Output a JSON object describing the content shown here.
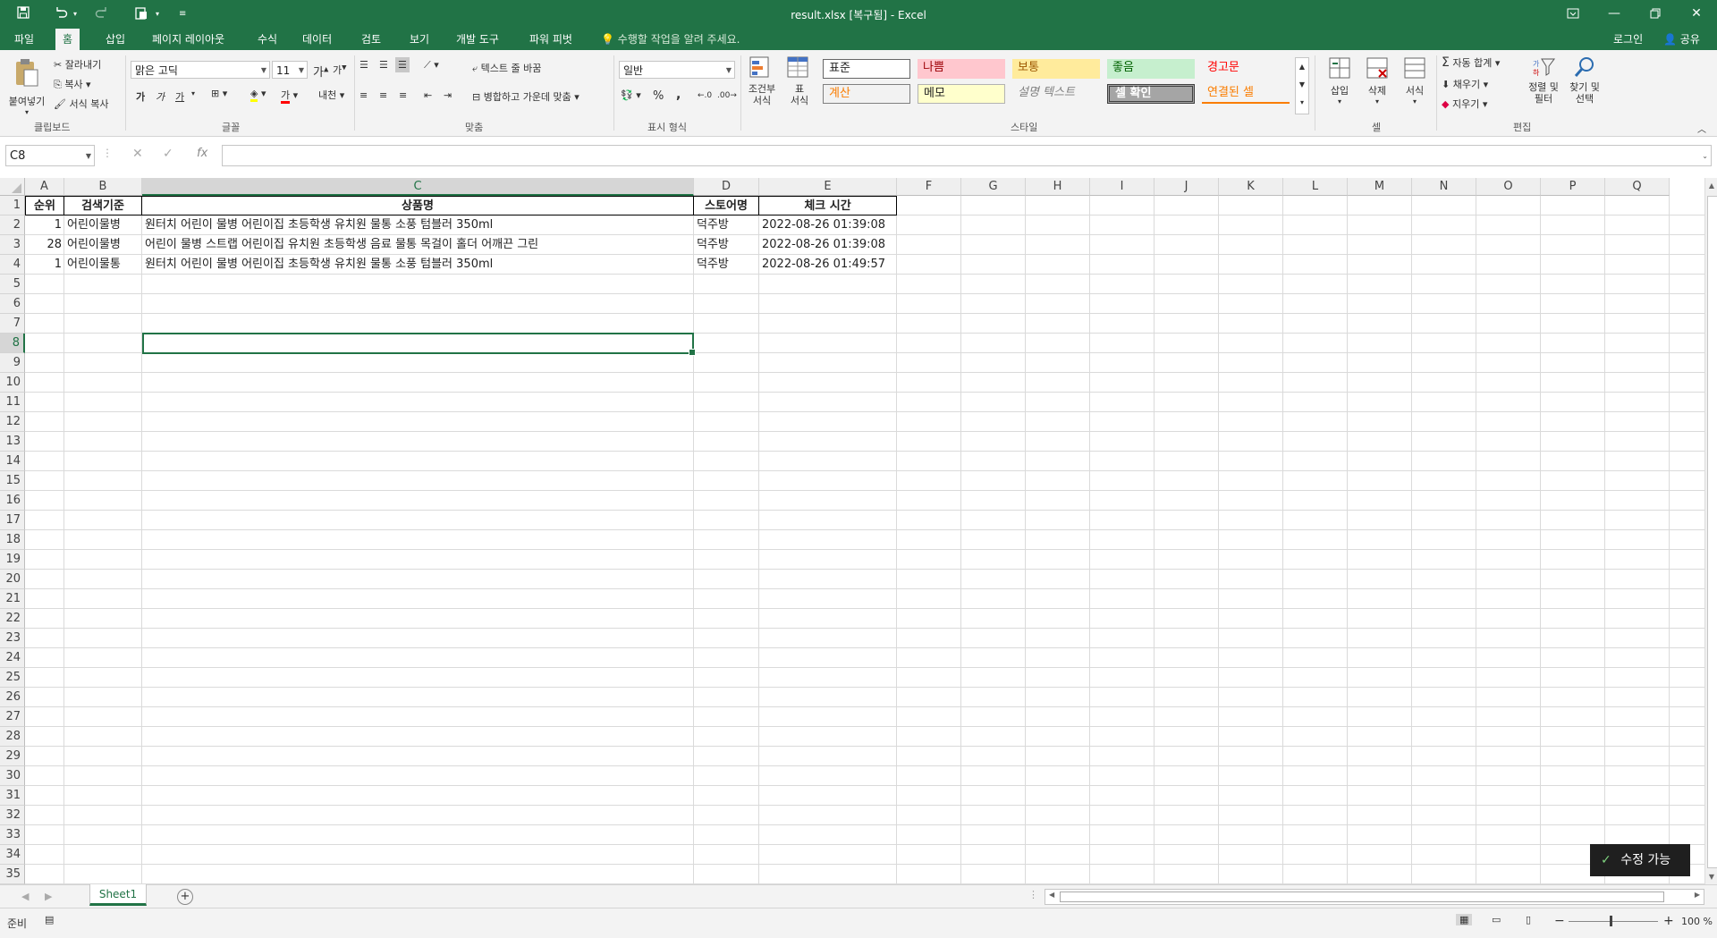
{
  "window": {
    "title": "result.xlsx [복구됨] - Excel"
  },
  "tabs": {
    "file": "파일",
    "home": "홈",
    "insert": "삽입",
    "page_layout": "페이지 레이아웃",
    "formulas": "수식",
    "data": "데이터",
    "review": "검토",
    "view": "보기",
    "developer": "개발 도구",
    "power_pivot": "파워 피벗",
    "tell_me": "수행할 작업을 알려 주세요.",
    "login": "로그인",
    "share": "공유"
  },
  "ribbon": {
    "clipboard": {
      "paste": "붙여넣기",
      "cut": "잘라내기",
      "copy": "복사",
      "format_painter": "서식 복사",
      "label": "클립보드"
    },
    "font": {
      "name": "맑은 고딕",
      "size": "11",
      "bold": "가",
      "italic": "가",
      "underline": "가",
      "label": "글꼴",
      "phonetic": "내천"
    },
    "alignment": {
      "wrap_text": "텍스트 줄 바꿈",
      "merge_center": "병합하고 가운데 맞춤",
      "label": "맞춤"
    },
    "number": {
      "format": "일반",
      "label": "표시 형식",
      "percent": "%",
      "comma": ","
    },
    "styles": {
      "conditional": "조건부\n서식",
      "table": "표\n서식",
      "label": "스타일",
      "cells": [
        "표준",
        "나쁨",
        "보통",
        "좋음",
        "경고문",
        "계산",
        "메모",
        "설명 텍스트",
        "셀 확인",
        "연결된 셀"
      ],
      "colors": {
        "bad_bg": "#ffc7ce",
        "bad_fg": "#9c0006",
        "neutral_bg": "#ffeb9c",
        "neutral_fg": "#9c5700",
        "good_bg": "#c6efce",
        "good_fg": "#006100",
        "warning_fg": "#ff0000",
        "calc_fg": "#fa7d00",
        "linked_fg": "#fa7d00",
        "check_bg": "#a5a5a5"
      }
    },
    "cells": {
      "insert": "삽입",
      "delete": "삭제",
      "format": "서식",
      "label": "셀"
    },
    "editing": {
      "autosum": "자동 합계",
      "fill": "채우기",
      "clear": "지우기",
      "sort": "정렬 및\n필터",
      "find": "찾기 및\n선택",
      "label": "편집"
    }
  },
  "formula_bar": {
    "name_box": "C8",
    "fx": "fx",
    "value": ""
  },
  "grid": {
    "columns": [
      "A",
      "B",
      "C",
      "D",
      "E",
      "F",
      "G",
      "H",
      "I",
      "J",
      "K",
      "L",
      "M",
      "N",
      "O",
      "P",
      "Q"
    ],
    "rows": [
      "1",
      "2",
      "3",
      "4",
      "5",
      "6",
      "7",
      "8",
      "9",
      "10",
      "11",
      "12",
      "13",
      "14",
      "15",
      "16",
      "17",
      "18",
      "19",
      "20",
      "21",
      "22",
      "23",
      "24",
      "25",
      "26",
      "27",
      "28",
      "29",
      "30",
      "31",
      "32",
      "33",
      "34",
      "35"
    ],
    "selected_cell": "C8",
    "header": [
      "순위",
      "검색기준",
      "상품명",
      "스토어명",
      "체크 시간"
    ],
    "data": [
      [
        "1",
        "어린이물병",
        "원터치 어린이 물병 어린이집 초등학생 유치원 물통 소풍 텀블러 350ml",
        "덕주방",
        "2022-08-26 01:39:08"
      ],
      [
        "28",
        "어린이물병",
        "어린이 물병 스트랩 어린이집 유치원 초등학생 음료 물통 목걸이 홀더 어깨끈 그린",
        "덕주방",
        "2022-08-26 01:39:08"
      ],
      [
        "1",
        "어린이물통",
        "원터치 어린이 물병 어린이집 초등학생 유치원 물통 소풍 텀블러 350ml",
        "덕주방",
        "2022-08-26 01:49:57"
      ]
    ]
  },
  "sheets": {
    "active": "Sheet1"
  },
  "status": {
    "ready": "준비",
    "zoom": "100 %"
  },
  "toast": {
    "label": "수정 가능"
  },
  "accent": "#217346"
}
